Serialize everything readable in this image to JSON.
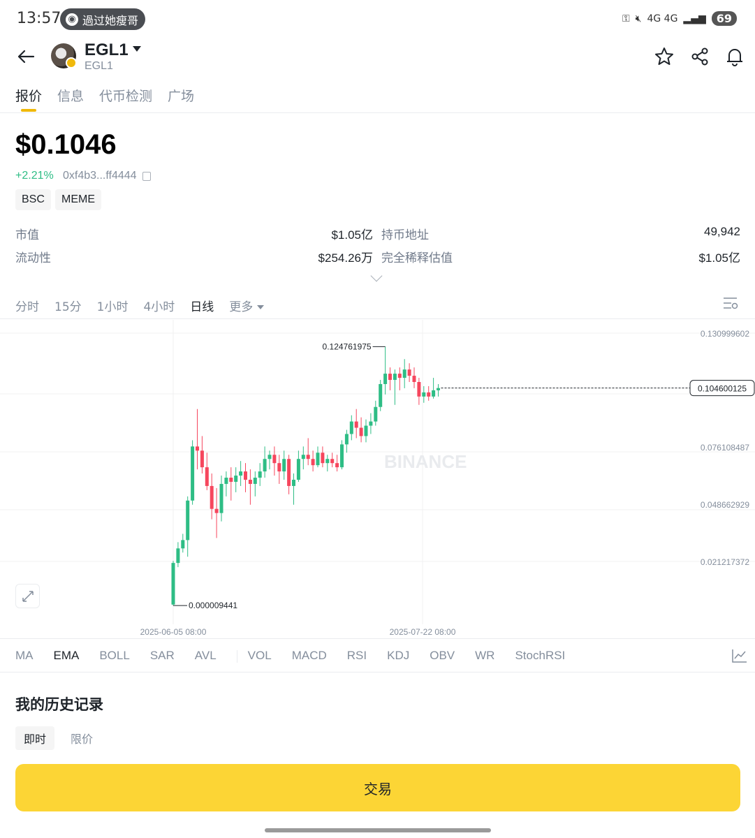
{
  "status_bar": {
    "time": "13:57",
    "pill_text": "過过她瘦哥",
    "network": "4G 4G",
    "battery": "69"
  },
  "header": {
    "symbol": "EGL1",
    "subtitle": "EGL1"
  },
  "tabs": [
    "报价",
    "信息",
    "代币检测",
    "广场"
  ],
  "quote": {
    "price": "$0.1046",
    "change": "+2.21%",
    "address": "0xf4b3...ff4444",
    "tags": [
      "BSC",
      "MEME"
    ]
  },
  "stats": {
    "market_cap_label": "市值",
    "market_cap": "$1.05亿",
    "holders_label": "持币地址",
    "holders": "49,942",
    "liquidity_label": "流动性",
    "liquidity": "$254.26万",
    "fdv_label": "完全稀释估值",
    "fdv": "$1.05亿"
  },
  "intervals": [
    "分时",
    "15分",
    "1小时",
    "4小时",
    "日线",
    "更多"
  ],
  "active_interval": "日线",
  "chart_data": {
    "type": "candlestick",
    "y_ticks": [
      "0.130999602",
      "0.076108487",
      "0.048662929",
      "0.021217372"
    ],
    "current_price_label": "0.104600125",
    "high_label": "0.124761975",
    "low_label": "0.000009441",
    "x_ticks": [
      "2025-06-05 08:00",
      "2025-07-22 08:00"
    ],
    "watermark": "BINANCE",
    "colors": {
      "up": "#2ebd85",
      "down": "#f6465d"
    },
    "candles": [
      {
        "o": 0.0005,
        "h": 0.0215,
        "l": 1e-05,
        "c": 0.0205
      },
      {
        "o": 0.0205,
        "h": 0.0305,
        "l": 0.0185,
        "c": 0.0275
      },
      {
        "o": 0.0275,
        "h": 0.0345,
        "l": 0.0255,
        "c": 0.0315
      },
      {
        "o": 0.0315,
        "h": 0.0525,
        "l": 0.0235,
        "c": 0.0505
      },
      {
        "o": 0.0505,
        "h": 0.0795,
        "l": 0.0485,
        "c": 0.0765
      },
      {
        "o": 0.0765,
        "h": 0.0945,
        "l": 0.0655,
        "c": 0.0745
      },
      {
        "o": 0.0745,
        "h": 0.0815,
        "l": 0.0635,
        "c": 0.0665
      },
      {
        "o": 0.0665,
        "h": 0.0735,
        "l": 0.0555,
        "c": 0.0575
      },
      {
        "o": 0.0575,
        "h": 0.0635,
        "l": 0.0415,
        "c": 0.0465
      },
      {
        "o": 0.0465,
        "h": 0.0565,
        "l": 0.0325,
        "c": 0.0445
      },
      {
        "o": 0.0445,
        "h": 0.0625,
        "l": 0.0405,
        "c": 0.0585
      },
      {
        "o": 0.0585,
        "h": 0.0645,
        "l": 0.0525,
        "c": 0.0615
      },
      {
        "o": 0.0615,
        "h": 0.0665,
        "l": 0.0505,
        "c": 0.0595
      },
      {
        "o": 0.0595,
        "h": 0.0665,
        "l": 0.0545,
        "c": 0.0625
      },
      {
        "o": 0.0625,
        "h": 0.0695,
        "l": 0.0575,
        "c": 0.0645
      },
      {
        "o": 0.0645,
        "h": 0.0685,
        "l": 0.0545,
        "c": 0.0605
      },
      {
        "o": 0.0605,
        "h": 0.0655,
        "l": 0.0485,
        "c": 0.0585
      },
      {
        "o": 0.0585,
        "h": 0.0645,
        "l": 0.0525,
        "c": 0.0615
      },
      {
        "o": 0.0615,
        "h": 0.0685,
        "l": 0.0575,
        "c": 0.0645
      },
      {
        "o": 0.0645,
        "h": 0.0765,
        "l": 0.0615,
        "c": 0.0705
      },
      {
        "o": 0.0705,
        "h": 0.0745,
        "l": 0.0655,
        "c": 0.0725
      },
      {
        "o": 0.0725,
        "h": 0.0765,
        "l": 0.0625,
        "c": 0.0685
      },
      {
        "o": 0.0685,
        "h": 0.0725,
        "l": 0.0585,
        "c": 0.0645
      },
      {
        "o": 0.0645,
        "h": 0.0745,
        "l": 0.0605,
        "c": 0.0705
      },
      {
        "o": 0.0705,
        "h": 0.0725,
        "l": 0.0535,
        "c": 0.0575
      },
      {
        "o": 0.0575,
        "h": 0.0635,
        "l": 0.0485,
        "c": 0.0605
      },
      {
        "o": 0.0605,
        "h": 0.0745,
        "l": 0.0595,
        "c": 0.0705
      },
      {
        "o": 0.0705,
        "h": 0.0765,
        "l": 0.0655,
        "c": 0.0725
      },
      {
        "o": 0.0725,
        "h": 0.0805,
        "l": 0.0675,
        "c": 0.0705
      },
      {
        "o": 0.0705,
        "h": 0.0745,
        "l": 0.0645,
        "c": 0.0675
      },
      {
        "o": 0.0675,
        "h": 0.0765,
        "l": 0.0665,
        "c": 0.0735
      },
      {
        "o": 0.0735,
        "h": 0.0765,
        "l": 0.0665,
        "c": 0.0685
      },
      {
        "o": 0.0685,
        "h": 0.0725,
        "l": 0.0645,
        "c": 0.0705
      },
      {
        "o": 0.0705,
        "h": 0.0735,
        "l": 0.0665,
        "c": 0.0685
      },
      {
        "o": 0.0685,
        "h": 0.0725,
        "l": 0.0645,
        "c": 0.0665
      },
      {
        "o": 0.0665,
        "h": 0.0795,
        "l": 0.0655,
        "c": 0.0775
      },
      {
        "o": 0.0775,
        "h": 0.0845,
        "l": 0.0735,
        "c": 0.0825
      },
      {
        "o": 0.0825,
        "h": 0.0915,
        "l": 0.0795,
        "c": 0.0885
      },
      {
        "o": 0.0885,
        "h": 0.0945,
        "l": 0.0805,
        "c": 0.0855
      },
      {
        "o": 0.0855,
        "h": 0.0905,
        "l": 0.0785,
        "c": 0.0815
      },
      {
        "o": 0.0815,
        "h": 0.0895,
        "l": 0.0785,
        "c": 0.0865
      },
      {
        "o": 0.0865,
        "h": 0.0925,
        "l": 0.0825,
        "c": 0.0885
      },
      {
        "o": 0.0885,
        "h": 0.0985,
        "l": 0.0865,
        "c": 0.0955
      },
      {
        "o": 0.0955,
        "h": 0.1085,
        "l": 0.0935,
        "c": 0.1065
      },
      {
        "o": 0.1065,
        "h": 0.1245,
        "l": 0.1015,
        "c": 0.1115
      },
      {
        "o": 0.1115,
        "h": 0.1145,
        "l": 0.1035,
        "c": 0.1085
      },
      {
        "o": 0.1085,
        "h": 0.1135,
        "l": 0.0965,
        "c": 0.1115
      },
      {
        "o": 0.1115,
        "h": 0.1145,
        "l": 0.1035,
        "c": 0.1095
      },
      {
        "o": 0.1095,
        "h": 0.1185,
        "l": 0.1045,
        "c": 0.1135
      },
      {
        "o": 0.1135,
        "h": 0.1165,
        "l": 0.1075,
        "c": 0.1105
      },
      {
        "o": 0.1105,
        "h": 0.1145,
        "l": 0.1045,
        "c": 0.1075
      },
      {
        "o": 0.1075,
        "h": 0.1095,
        "l": 0.0965,
        "c": 0.1005
      },
      {
        "o": 0.1005,
        "h": 0.1055,
        "l": 0.0975,
        "c": 0.1025
      },
      {
        "o": 0.1025,
        "h": 0.1055,
        "l": 0.0985,
        "c": 0.1005
      },
      {
        "o": 0.1005,
        "h": 0.1095,
        "l": 0.0995,
        "c": 0.1035
      },
      {
        "o": 0.1035,
        "h": 0.1065,
        "l": 0.1005,
        "c": 0.1046
      }
    ]
  },
  "indicators": [
    "MA",
    "EMA",
    "BOLL",
    "SAR",
    "AVL",
    "VOL",
    "MACD",
    "RSI",
    "KDJ",
    "OBV",
    "WR",
    "StochRSI"
  ],
  "active_indicator": "EMA",
  "history": {
    "title": "我的历史记录",
    "tabs": [
      "即时",
      "限价"
    ]
  },
  "trade_button": "交易"
}
